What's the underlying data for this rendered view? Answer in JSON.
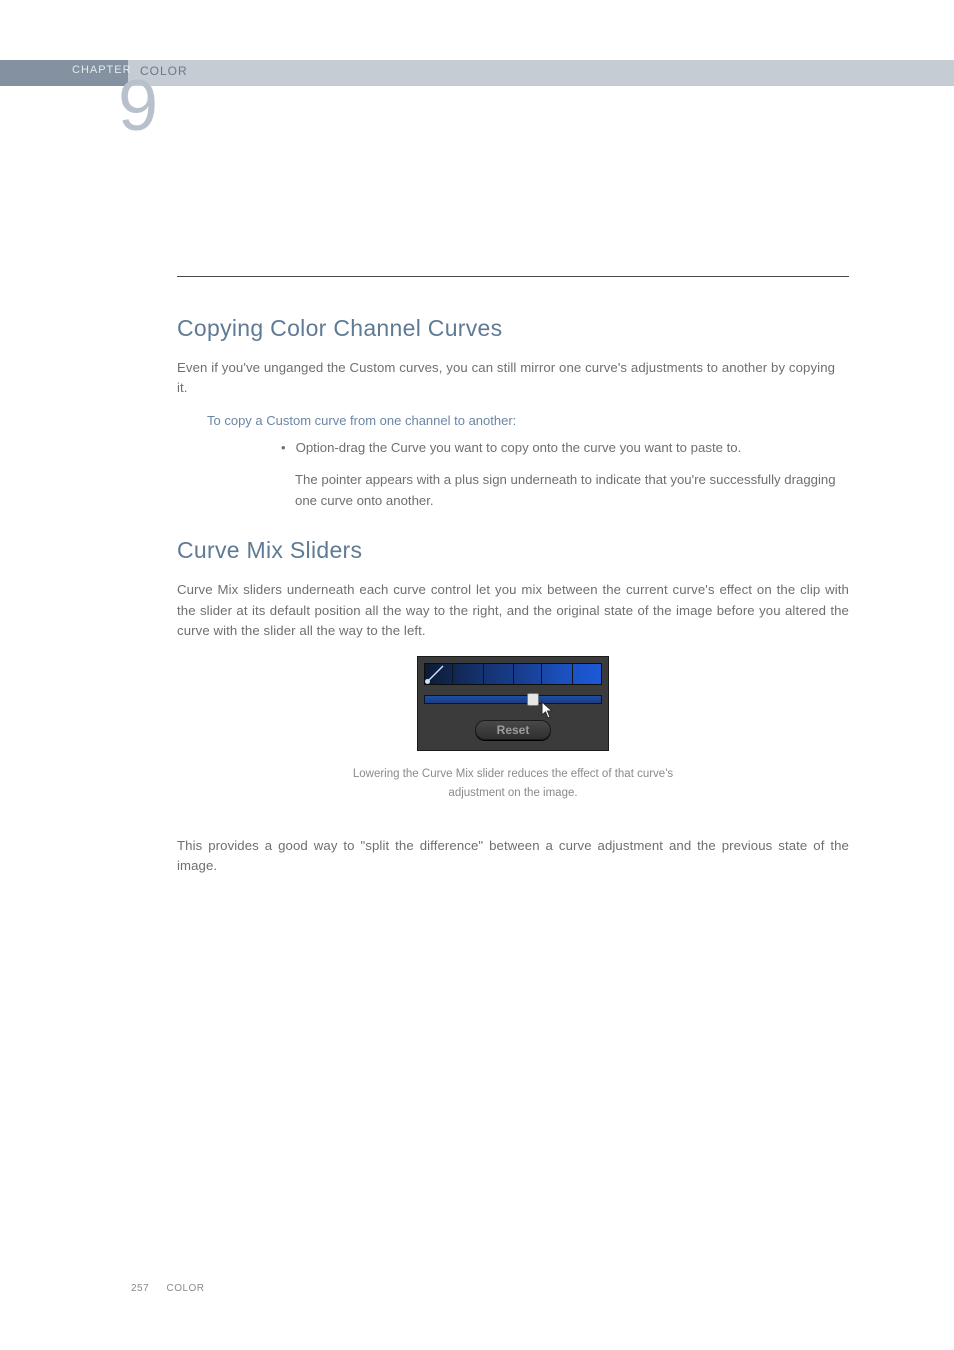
{
  "header": {
    "chapter_label": "CHAPTER",
    "chapter_number": "9",
    "title": "COLOR"
  },
  "sections": {
    "copying": {
      "heading": "Copying Color Channel Curves",
      "intro": "Even if you've unganged the Custom curves, you can still mirror one curve's adjustments to another by copying it.",
      "subhead": "To copy a Custom curve from one channel to another:",
      "bullet": "Option-drag the Curve you want to copy onto the curve you want to paste to.",
      "bullet_sub": "The pointer appears with a plus sign underneath to indicate that you're successfully dragging one curve onto another."
    },
    "curvemix": {
      "heading": "Curve Mix Sliders",
      "intro": "Curve Mix sliders underneath each curve control let you mix between the current curve's effect on the clip with the slider at its default position all the way to the right, and the original state of the image before you altered the curve with the slider all the way to the left.",
      "figure": {
        "reset_label": "Reset",
        "caption_line1": "Lowering the Curve Mix slider reduces the effect of that curve's",
        "caption_line2": "adjustment on the image."
      },
      "outro": "This provides a good way to \"split the difference\" between a curve adjustment and the previous state of the image."
    }
  },
  "footer": {
    "page_number": "257",
    "title": "COLOR"
  }
}
